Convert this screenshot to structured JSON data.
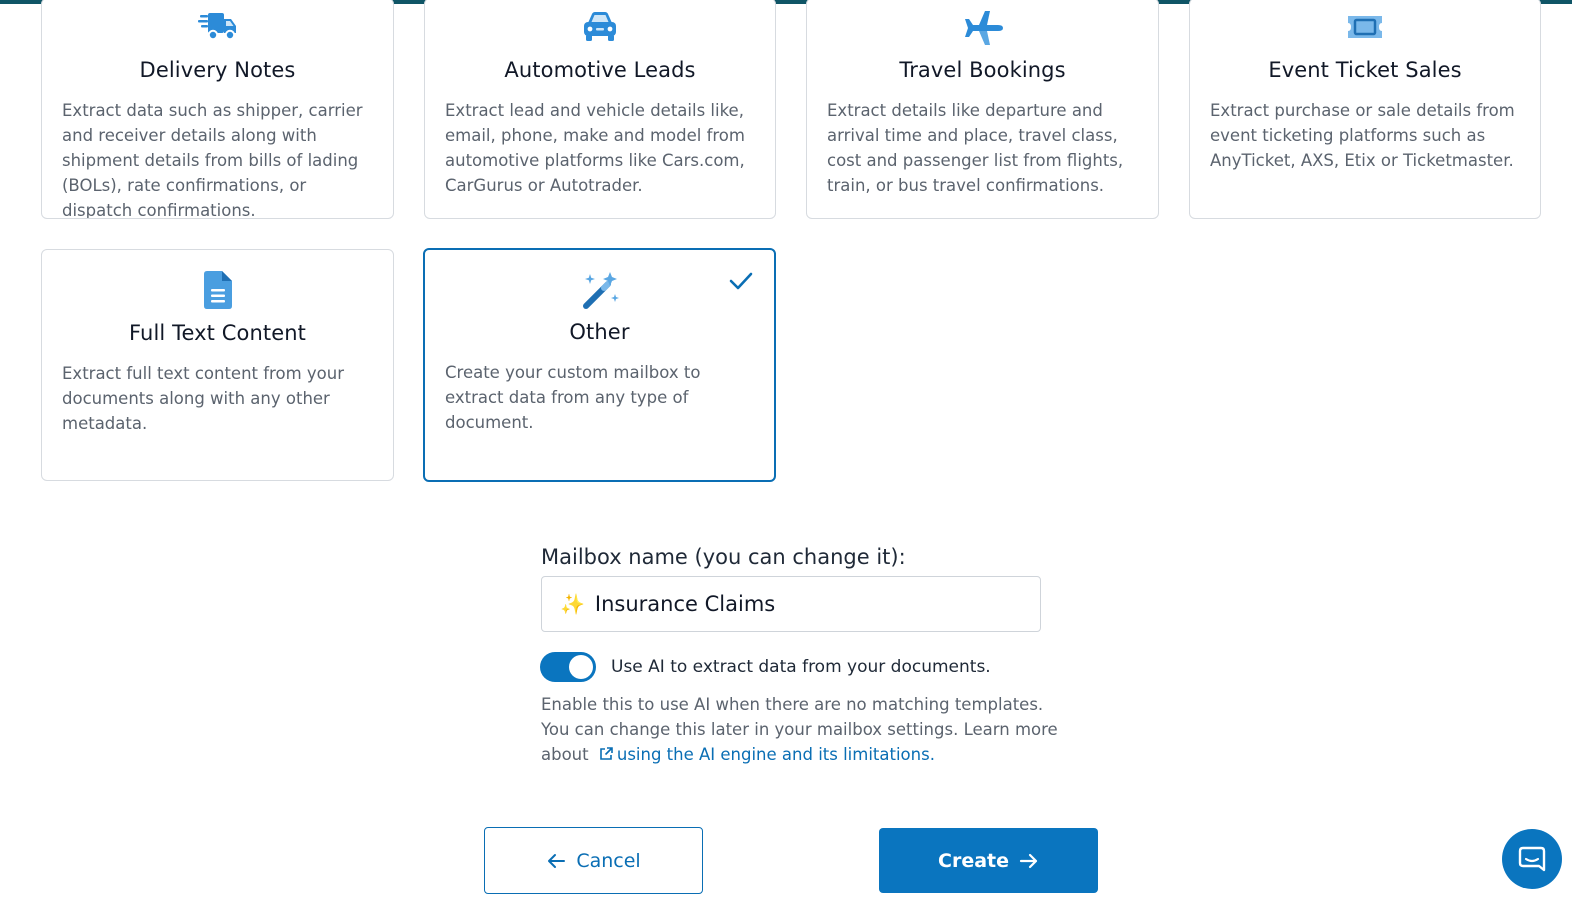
{
  "colors": {
    "accent": "#0a75bf",
    "link": "#0a6eb4",
    "icon": "#2c8bd8",
    "top_bar": "#0f5566"
  },
  "cards": [
    {
      "title": "Delivery Notes",
      "icon": "delivery-truck-icon",
      "description": "Extract data such as shipper, carrier and receiver details along with shipment details from bills of lading (BOLs), rate confirmations, or dispatch confirmations.",
      "selected": false
    },
    {
      "title": "Automotive Leads",
      "icon": "car-icon",
      "description": "Extract lead and vehicle details like, email, phone, make and model from automotive platforms like Cars.com, CarGurus or Autotrader.",
      "selected": false
    },
    {
      "title": "Travel Bookings",
      "icon": "airplane-icon",
      "description": "Extract details like departure and arrival time and place, travel class, cost and passenger list from flights, train, or bus travel confirmations.",
      "selected": false
    },
    {
      "title": "Event Ticket Sales",
      "icon": "ticket-icon",
      "description": "Extract purchase or sale details from event ticketing platforms such as AnyTicket, AXS, Etix or Ticketmaster.",
      "selected": false
    },
    {
      "title": "Full Text Content",
      "icon": "document-icon",
      "description": "Extract full text content from your documents along with any other metadata.",
      "selected": false
    },
    {
      "title": "Other",
      "icon": "magic-wand-icon",
      "description": "Create your custom mailbox to extract data from any type of document.",
      "selected": true
    }
  ],
  "form": {
    "mailbox_label": "Mailbox name (you can change it):",
    "mailbox_emoji": "✨",
    "mailbox_value": "Insurance Claims",
    "ai_toggle_on": true,
    "ai_toggle_label": "Use AI to extract data from your documents.",
    "help_text": "Enable this to use AI when there are no matching templates. You can change this later in your mailbox settings. Learn more about",
    "help_link": "using the AI engine and its limitations."
  },
  "buttons": {
    "cancel": "Cancel",
    "create": "Create"
  }
}
